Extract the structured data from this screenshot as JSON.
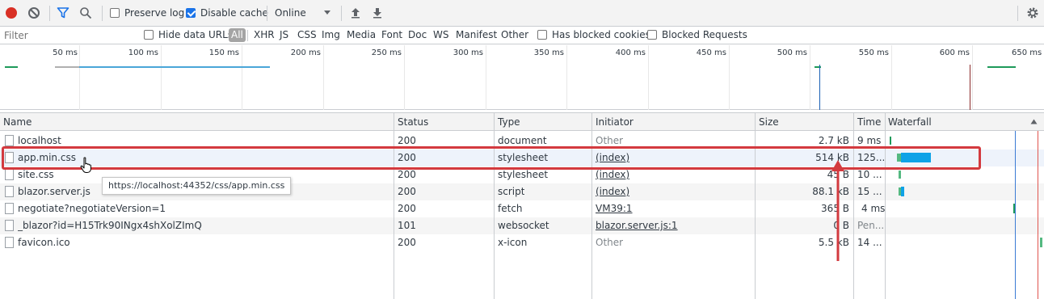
{
  "toolbar": {
    "preserve_log_label": "Preserve log",
    "preserve_log_checked": false,
    "disable_cache_label": "Disable cache",
    "disable_cache_checked": true,
    "throttling_value": "Online"
  },
  "filterbar": {
    "filter_placeholder": "Filter",
    "hide_data_urls_label": "Hide data URLs",
    "type_filters": [
      "All",
      "XHR",
      "JS",
      "CSS",
      "Img",
      "Media",
      "Font",
      "Doc",
      "WS",
      "Manifest",
      "Other"
    ],
    "active_filter": "All",
    "has_blocked_cookies_label": "Has blocked cookies",
    "blocked_requests_label": "Blocked Requests"
  },
  "overview": {
    "time_labels": [
      "50 ms",
      "100 ms",
      "150 ms",
      "200 ms",
      "250 ms",
      "300 ms",
      "350 ms",
      "400 ms",
      "450 ms",
      "500 ms",
      "550 ms",
      "600 ms",
      "650 ms"
    ]
  },
  "table": {
    "columns": {
      "name": "Name",
      "status": "Status",
      "type": "Type",
      "initiator": "Initiator",
      "size": "Size",
      "time": "Time",
      "waterfall": "Waterfall"
    },
    "rows": [
      {
        "name": "localhost",
        "status": "200",
        "type": "document",
        "initiator": "Other",
        "size": "2.7 kB",
        "time": "9 ms"
      },
      {
        "name": "app.min.css",
        "status": "200",
        "type": "stylesheet",
        "initiator": "(index)",
        "size": "514 kB",
        "time": "125..."
      },
      {
        "name": "site.css",
        "status": "200",
        "type": "stylesheet",
        "initiator": "(index)",
        "size": "45 B",
        "time": "10 ..."
      },
      {
        "name": "blazor.server.js",
        "status": "200",
        "type": "script",
        "initiator": "(index)",
        "size": "88.1 kB",
        "time": "15 ..."
      },
      {
        "name": "negotiate?negotiateVersion=1",
        "status": "200",
        "type": "fetch",
        "initiator": "VM39:1",
        "size": "365 B",
        "time": "4 ms"
      },
      {
        "name": "_blazor?id=H15Trk90INgx4shXolZImQ",
        "status": "101",
        "type": "websocket",
        "initiator": "blazor.server.js:1",
        "size": "0 B",
        "time": "Pen..."
      },
      {
        "name": "favicon.ico",
        "status": "200",
        "type": "x-icon",
        "initiator": "Other",
        "size": "5.5 kB",
        "time": "14 ..."
      }
    ]
  },
  "tooltip": {
    "text": "https://localhost:44352/css/app.min.css"
  },
  "colors": {
    "record_red": "#d93025",
    "accent_blue": "#1a73e8",
    "annotation_red": "#d33a3f",
    "waterfall_bar": "#0ea2e7"
  }
}
